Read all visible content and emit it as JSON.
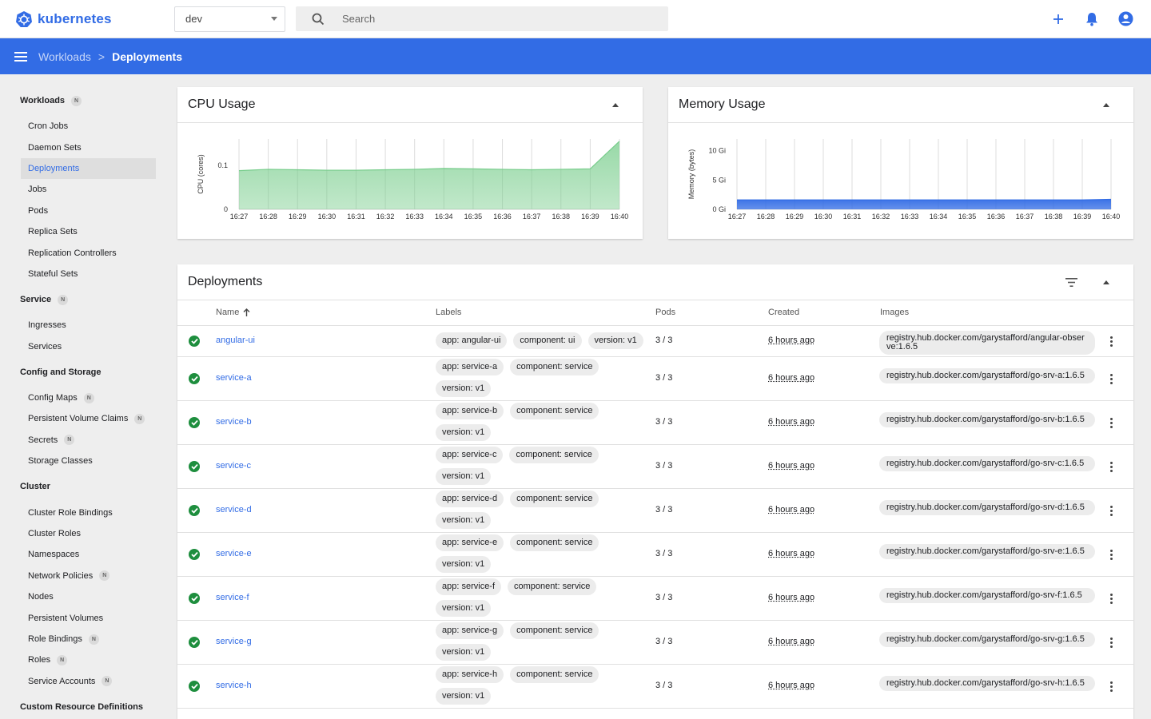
{
  "app": {
    "brand": "kubernetes"
  },
  "namespace": {
    "selected": "dev"
  },
  "search": {
    "placeholder": "Search"
  },
  "breadcrumb": {
    "parent": "Workloads",
    "separator": ">",
    "current": "Deployments"
  },
  "sidebar": {
    "sections": [
      {
        "title": "Workloads",
        "badge": "N",
        "items": [
          {
            "label": "Cron Jobs"
          },
          {
            "label": "Daemon Sets"
          },
          {
            "label": "Deployments",
            "active": true
          },
          {
            "label": "Jobs"
          },
          {
            "label": "Pods"
          },
          {
            "label": "Replica Sets"
          },
          {
            "label": "Replication Controllers"
          },
          {
            "label": "Stateful Sets"
          }
        ]
      },
      {
        "title": "Service",
        "badge": "N",
        "items": [
          {
            "label": "Ingresses"
          },
          {
            "label": "Services"
          }
        ]
      },
      {
        "title": "Config and Storage",
        "items": [
          {
            "label": "Config Maps",
            "badge": "N"
          },
          {
            "label": "Persistent Volume Claims",
            "badge": "N"
          },
          {
            "label": "Secrets",
            "badge": "N"
          },
          {
            "label": "Storage Classes"
          }
        ]
      },
      {
        "title": "Cluster",
        "items": [
          {
            "label": "Cluster Role Bindings"
          },
          {
            "label": "Cluster Roles"
          },
          {
            "label": "Namespaces"
          },
          {
            "label": "Network Policies",
            "badge": "N"
          },
          {
            "label": "Nodes"
          },
          {
            "label": "Persistent Volumes"
          },
          {
            "label": "Role Bindings",
            "badge": "N"
          },
          {
            "label": "Roles",
            "badge": "N"
          },
          {
            "label": "Service Accounts",
            "badge": "N"
          }
        ]
      },
      {
        "title": "Custom Resource Definitions",
        "items": []
      }
    ]
  },
  "cpu_card": {
    "title": "CPU Usage"
  },
  "memory_card": {
    "title": "Memory Usage"
  },
  "chart_data": [
    {
      "type": "area",
      "title": "CPU Usage",
      "ylabel": "CPU (cores)",
      "x": [
        "16:27",
        "16:28",
        "16:29",
        "16:30",
        "16:31",
        "16:32",
        "16:33",
        "16:34",
        "16:35",
        "16:36",
        "16:37",
        "16:38",
        "16:39",
        "16:40"
      ],
      "y": [
        0.088,
        0.091,
        0.09,
        0.089,
        0.089,
        0.09,
        0.091,
        0.093,
        0.092,
        0.091,
        0.09,
        0.091,
        0.092,
        0.155
      ],
      "yticks": [
        "0",
        "0.1"
      ],
      "ylim": [
        0,
        0.16
      ],
      "color": "#76cc8a"
    },
    {
      "type": "area",
      "title": "Memory Usage",
      "ylabel": "Memory (bytes)",
      "x": [
        "16:27",
        "16:28",
        "16:29",
        "16:30",
        "16:31",
        "16:32",
        "16:33",
        "16:34",
        "16:35",
        "16:36",
        "16:37",
        "16:38",
        "16:39",
        "16:40"
      ],
      "y": [
        1.6,
        1.6,
        1.6,
        1.6,
        1.6,
        1.6,
        1.6,
        1.6,
        1.6,
        1.6,
        1.6,
        1.6,
        1.6,
        1.7
      ],
      "y_unit": "Gi",
      "yticks": [
        "0 Gi",
        "5 Gi",
        "10 Gi"
      ],
      "ylim": [
        0,
        12
      ],
      "color": "#326ce5"
    }
  ],
  "deployments": {
    "title": "Deployments",
    "columns": {
      "name": "Name",
      "labels": "Labels",
      "pods": "Pods",
      "created": "Created",
      "images": "Images"
    },
    "rows": [
      {
        "name": "angular-ui",
        "labels": [
          "app: angular-ui",
          "component: ui",
          "version: v1"
        ],
        "pods": "3 / 3",
        "created": "6 hours ago",
        "image": "registry.hub.docker.com/garystafford/angular-observe:1.6.5"
      },
      {
        "name": "service-a",
        "labels": [
          "app: service-a",
          "component: service",
          "version: v1"
        ],
        "pods": "3 / 3",
        "created": "6 hours ago",
        "image": "registry.hub.docker.com/garystafford/go-srv-a:1.6.5"
      },
      {
        "name": "service-b",
        "labels": [
          "app: service-b",
          "component: service",
          "version: v1"
        ],
        "pods": "3 / 3",
        "created": "6 hours ago",
        "image": "registry.hub.docker.com/garystafford/go-srv-b:1.6.5"
      },
      {
        "name": "service-c",
        "labels": [
          "app: service-c",
          "component: service",
          "version: v1"
        ],
        "pods": "3 / 3",
        "created": "6 hours ago",
        "image": "registry.hub.docker.com/garystafford/go-srv-c:1.6.5"
      },
      {
        "name": "service-d",
        "labels": [
          "app: service-d",
          "component: service",
          "version: v1"
        ],
        "pods": "3 / 3",
        "created": "6 hours ago",
        "image": "registry.hub.docker.com/garystafford/go-srv-d:1.6.5"
      },
      {
        "name": "service-e",
        "labels": [
          "app: service-e",
          "component: service",
          "version: v1"
        ],
        "pods": "3 / 3",
        "created": "6 hours ago",
        "image": "registry.hub.docker.com/garystafford/go-srv-e:1.6.5"
      },
      {
        "name": "service-f",
        "labels": [
          "app: service-f",
          "component: service",
          "version: v1"
        ],
        "pods": "3 / 3",
        "created": "6 hours ago",
        "image": "registry.hub.docker.com/garystafford/go-srv-f:1.6.5"
      },
      {
        "name": "service-g",
        "labels": [
          "app: service-g",
          "component: service",
          "version: v1"
        ],
        "pods": "3 / 3",
        "created": "6 hours ago",
        "image": "registry.hub.docker.com/garystafford/go-srv-g:1.6.5"
      },
      {
        "name": "service-h",
        "labels": [
          "app: service-h",
          "component: service",
          "version: v1"
        ],
        "pods": "3 / 3",
        "created": "6 hours ago",
        "image": "registry.hub.docker.com/garystafford/go-srv-h:1.6.5"
      }
    ]
  }
}
